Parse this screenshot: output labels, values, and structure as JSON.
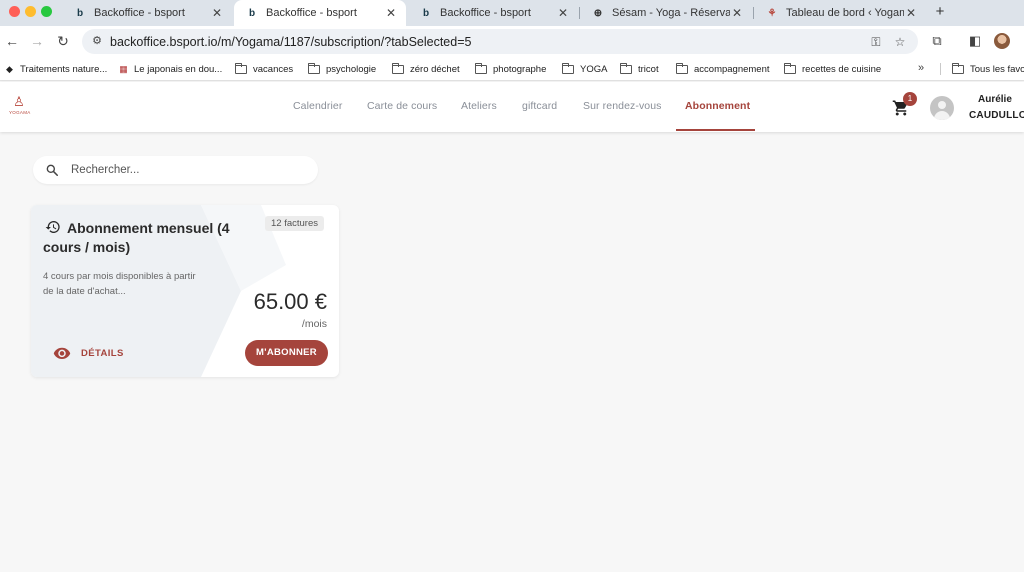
{
  "browser": {
    "tabs": [
      {
        "title": "Backoffice - bsport",
        "icon": "bsport-icon"
      },
      {
        "title": "Backoffice - bsport",
        "icon": "bsport-icon"
      },
      {
        "title": "Backoffice - bsport",
        "icon": "bsport-icon"
      },
      {
        "title": "Sésam - Yoga - Réservation e",
        "icon": "globe-icon"
      },
      {
        "title": "Tableau de bord ‹ Yogama —",
        "icon": "yoga-icon"
      }
    ],
    "active_tab": 1,
    "url": "backoffice.bsport.io/m/Yogama/1187/subscription/?tabSelected=5",
    "bookmarks": [
      {
        "label": "Traitements nature...",
        "icon": "site-icon"
      },
      {
        "label": "Le japonais en dou...",
        "icon": "site-icon"
      },
      {
        "label": "vacances",
        "icon": "folder-icon"
      },
      {
        "label": "psychologie",
        "icon": "folder-icon"
      },
      {
        "label": "zéro déchet",
        "icon": "folder-icon"
      },
      {
        "label": "photographe",
        "icon": "folder-icon"
      },
      {
        "label": "YOGA",
        "icon": "folder-icon"
      },
      {
        "label": "tricot",
        "icon": "folder-icon"
      },
      {
        "label": "accompagnement",
        "icon": "folder-icon"
      },
      {
        "label": "recettes de cuisine",
        "icon": "folder-icon"
      },
      {
        "label": "Tous les favoris",
        "icon": "folder-icon"
      }
    ],
    "bookmarks_more": "»"
  },
  "header": {
    "logo_text": "YOGAMA",
    "nav": [
      {
        "label": "Calendrier"
      },
      {
        "label": "Carte de cours"
      },
      {
        "label": "Ateliers"
      },
      {
        "label": "giftcard"
      },
      {
        "label": "Sur rendez-vous"
      },
      {
        "label": "Abonnement"
      }
    ],
    "active_nav": 5,
    "cart_count": "1",
    "user": {
      "first_name": "Aurélie",
      "last_name": "CAUDULLO"
    }
  },
  "search": {
    "placeholder": "Rechercher..."
  },
  "subscription": {
    "title": "Abonnement mensuel (4 cours / mois)",
    "badge": "12 factures",
    "description": "4 cours par mois disponibles à partir de la date d'achat...",
    "price": "65.00 €",
    "period": "/mois",
    "details_label": "DÉTAILS",
    "subscribe_label": "M'ABONNER"
  },
  "colors": {
    "accent": "#a5443c",
    "page_bg": "#f7f7f7"
  }
}
